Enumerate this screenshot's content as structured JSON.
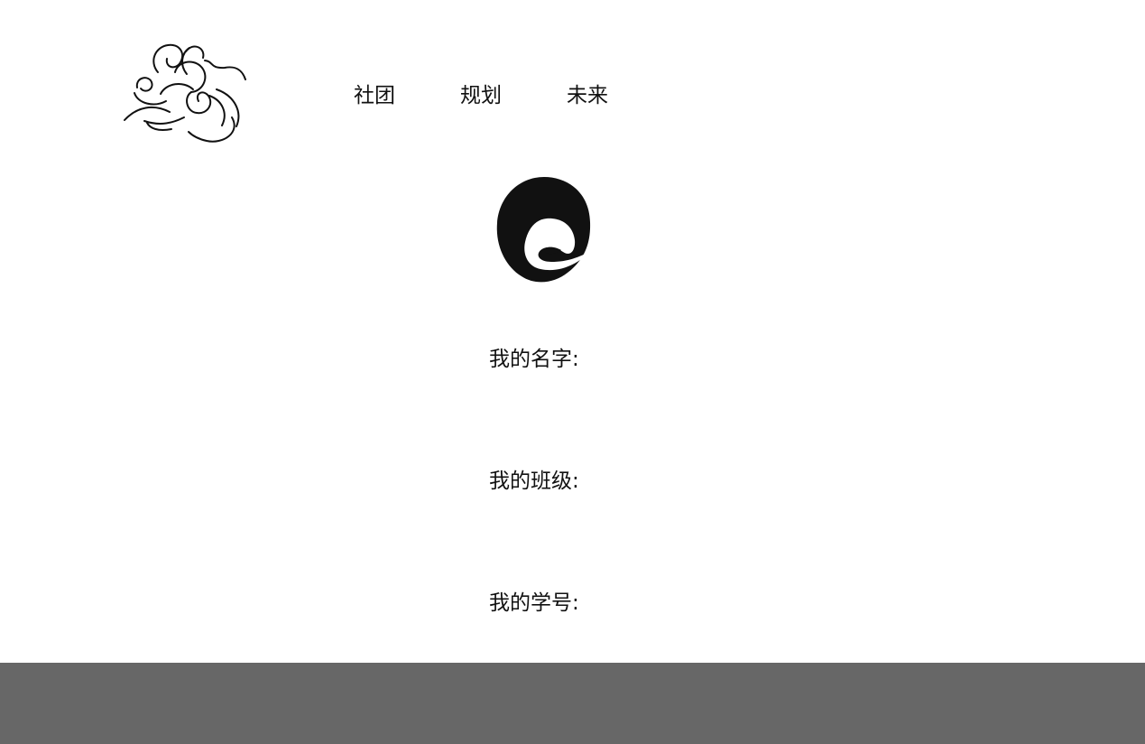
{
  "nav": {
    "items": [
      {
        "label": "社团"
      },
      {
        "label": "规划"
      },
      {
        "label": "未来"
      }
    ]
  },
  "profile": {
    "name_label": "我的名字:",
    "class_label": "我的班级:",
    "student_id_label": "我的学号:"
  },
  "icons": {
    "logo": "swirl-cloud-logo",
    "avatar": "swirl-avatar-icon"
  },
  "colors": {
    "background": "#ffffff",
    "text": "#111111",
    "footer": "#676767"
  }
}
